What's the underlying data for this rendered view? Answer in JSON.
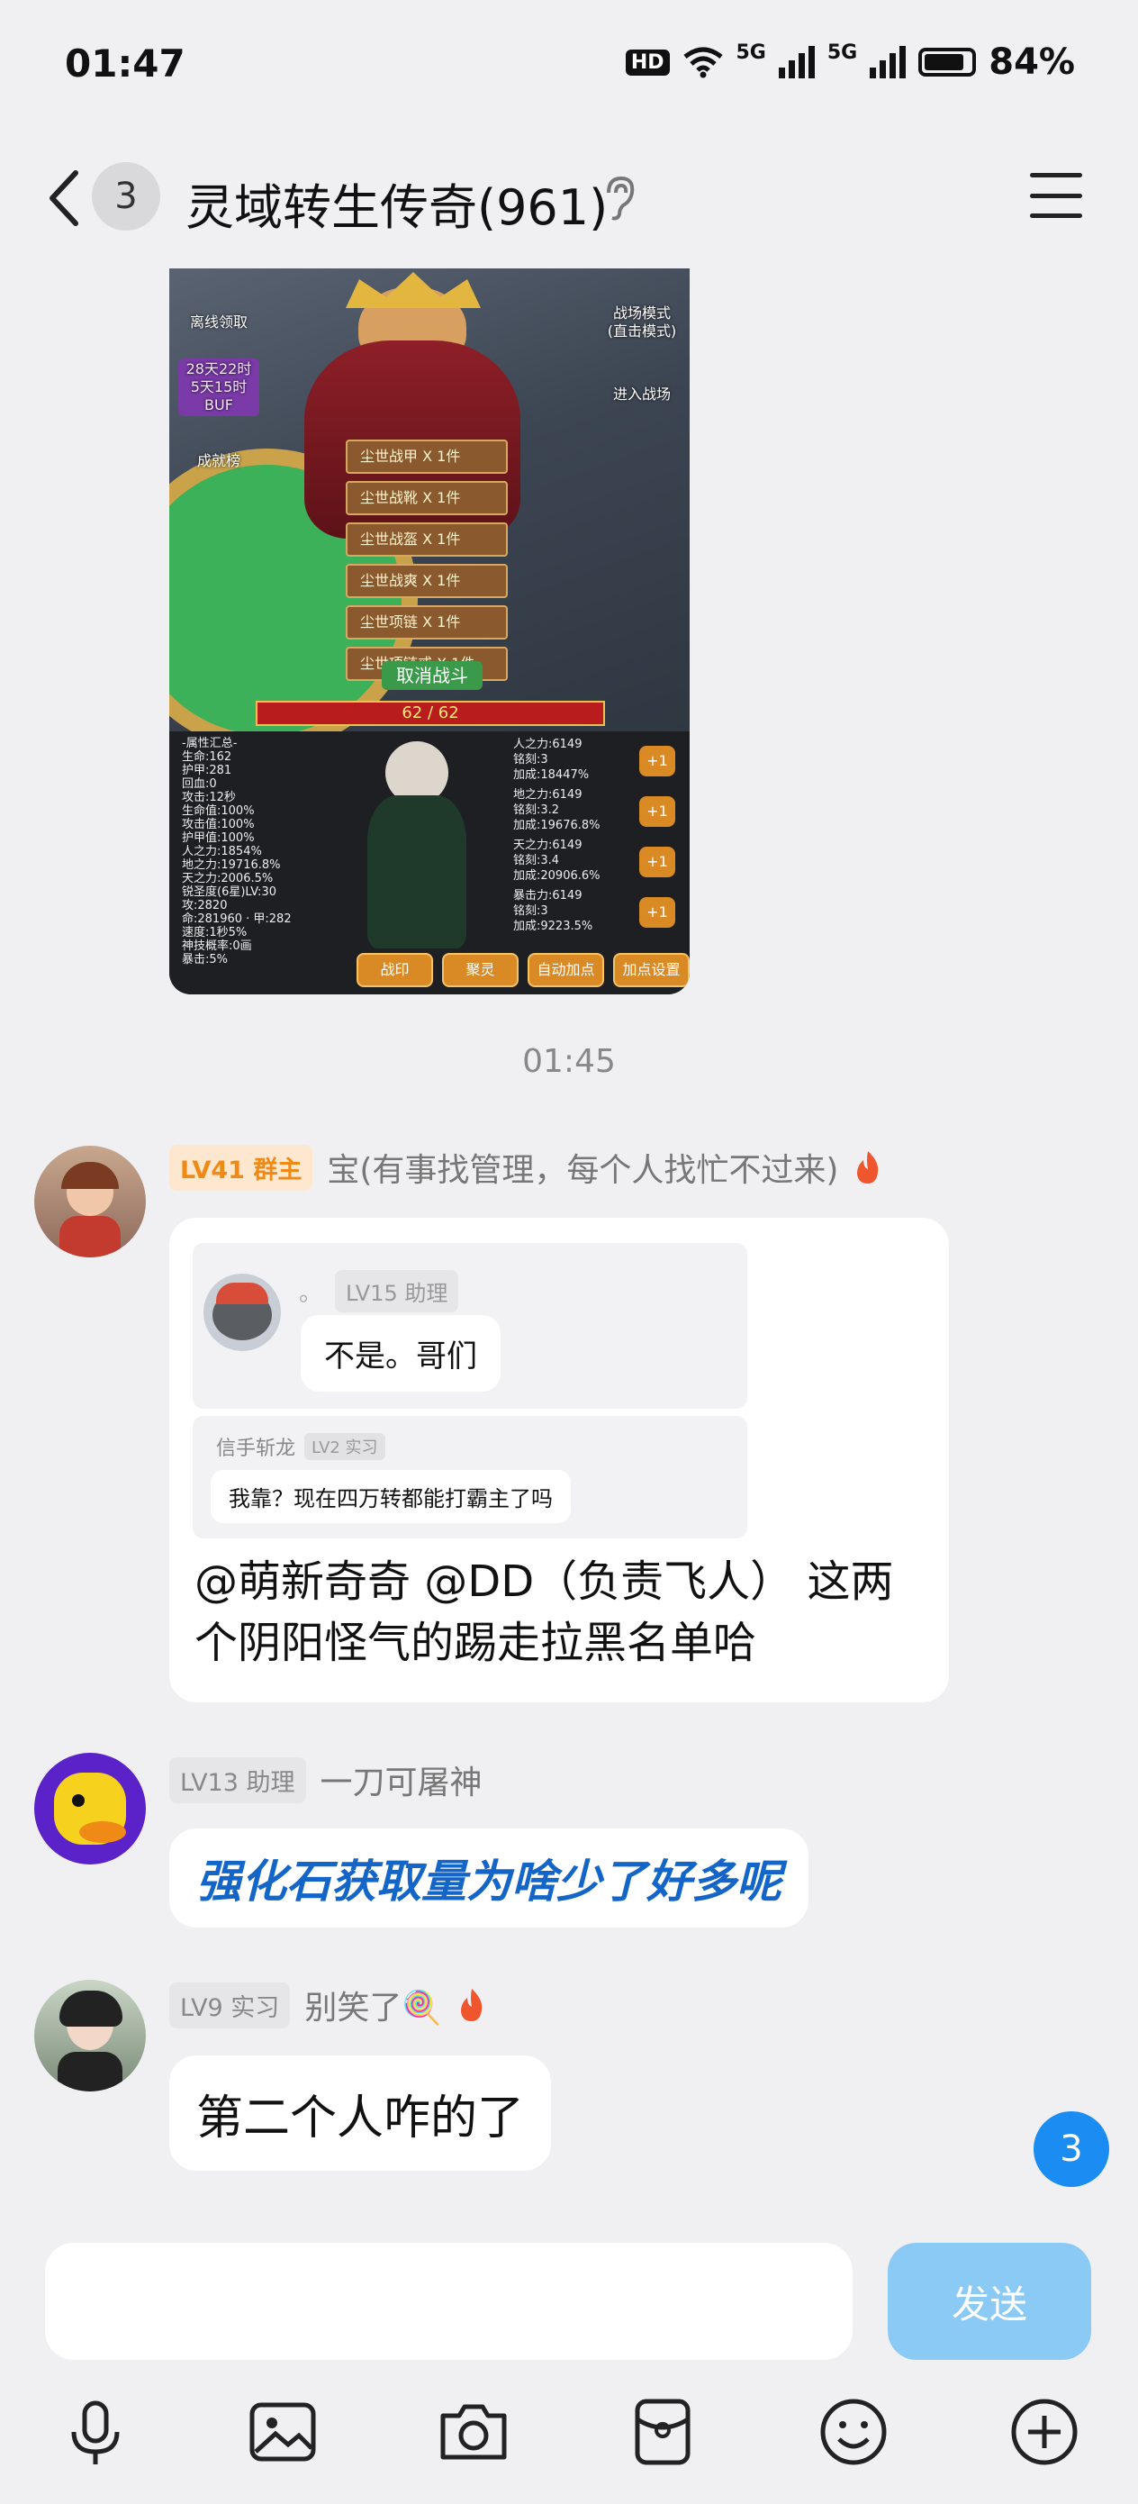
{
  "status_bar": {
    "time": "01:47",
    "network": "5G",
    "battery": "84%"
  },
  "header": {
    "unread_count": "3",
    "title": "灵域转生传奇(961)"
  },
  "game_image": {
    "left_labels": [
      "离线领取",
      "28天22时 5天15时 BUF",
      "成就榜"
    ],
    "right_labels": [
      "战场模式 (直击模式)",
      "进入战场"
    ],
    "loot_items": [
      "尘世战甲 X 1件",
      "尘世战靴 X 1件",
      "尘世战盔 X 1件",
      "尘世战爽 X 1件",
      "尘世项链 X 1件",
      "尘世项链戒 X 1件"
    ],
    "cancel_button": "取消战斗",
    "hp_bar": "62 / 62",
    "stats_left": [
      "-属性汇总-",
      "生命:162",
      "护甲:281",
      "回血:0",
      "攻击:12秒",
      "生命值:100%",
      "攻击值:100%",
      "护甲值:100%",
      "人之力:1854%",
      "地之力:19716.8%",
      "天之力:2006.5%",
      "锐圣度(6星)LV:30",
      "攻:2820",
      "命:281960 · 甲:282",
      "速度:1秒5%",
      "神技概率:0画",
      "暴击:5%"
    ],
    "stats_right": [
      {
        "name": "人之力:6149",
        "lv": "铭刻:3",
        "bonus": "加成:18447%"
      },
      {
        "name": "地之力:6149",
        "lv": "铭刻:3.2",
        "bonus": "加成:19676.8%"
      },
      {
        "name": "天之力:6149",
        "lv": "铭刻:3.4",
        "bonus": "加成:20906.6%"
      },
      {
        "name": "暴击力:6149",
        "lv": "铭刻:3",
        "bonus": "加成:9223.5%"
      }
    ],
    "plus_label": "+1",
    "bottom_buttons": [
      "战印",
      "聚灵",
      "自动加点",
      "加点设置"
    ]
  },
  "timestamp": "01:45",
  "messages": [
    {
      "level": "LV41 群主",
      "sender": "宝(有事找管理，每个人找忙不过来)",
      "quote1_level": "LV15 助理",
      "quote1_name": "。",
      "quote1_text": "不是。哥们",
      "quote2_name": "信手斩龙",
      "quote2_level": "LV2 实习",
      "quote2_text": "我靠？现在四万转都能打霸主了吗",
      "text": "@萌新奇奇 @DD（负责飞人） 这两个阴阳怪气的踢走拉黑名单哈"
    },
    {
      "level": "LV13 助理",
      "sender": "一刀可屠神",
      "text": "强化石获取量为啥少了好多呢"
    },
    {
      "level": "LV9 实习",
      "sender": "别笑了🍭",
      "text": "第二个人咋的了"
    }
  ],
  "unread_bubble": "3",
  "composer": {
    "input_value": "",
    "send_label": "发送"
  },
  "toolbar": [
    "microphone-icon",
    "image-icon",
    "camera-icon",
    "red-packet-icon",
    "emoji-icon",
    "plus-icon"
  ],
  "colors": {
    "accent_blue": "#1a8cf2",
    "send_disabled": "#8ccaf6",
    "owner_badge_bg": "#fde8cf",
    "owner_badge_fg": "#f08a16",
    "assistant_badge_bg": "#e6e6e9",
    "blue_text": "#1465c8"
  }
}
